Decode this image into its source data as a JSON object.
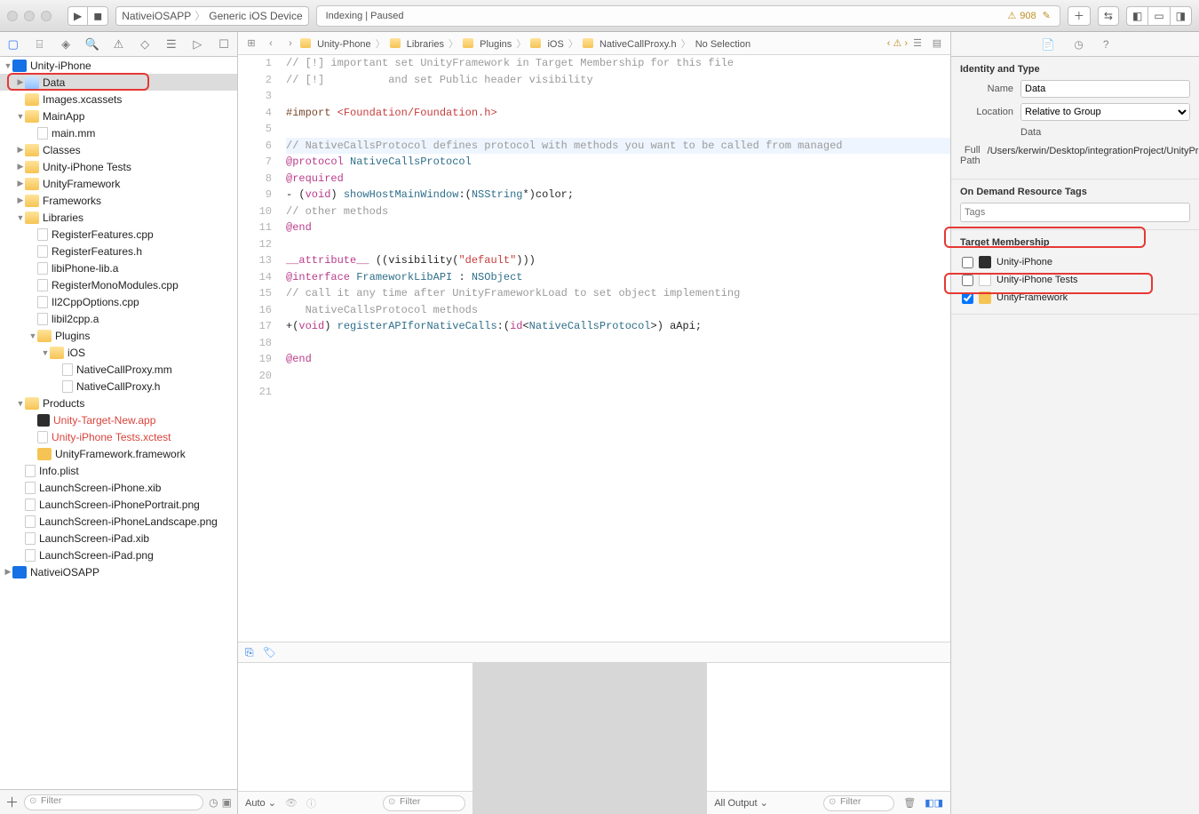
{
  "toolbar": {
    "scheme_app": "NativeiOSAPP",
    "scheme_device": "Generic iOS Device",
    "status_text": "Indexing | Paused",
    "warn_count": "908"
  },
  "navigator": {
    "project": "Unity-iPhone",
    "items": [
      {
        "l": 1,
        "t": "proj",
        "d": "▼",
        "label": "Unity-iPhone"
      },
      {
        "l": 2,
        "t": "folder-blue",
        "d": "▶",
        "label": "Data",
        "sel": true,
        "box": true
      },
      {
        "l": 2,
        "t": "folder",
        "d": "",
        "label": "Images.xcassets"
      },
      {
        "l": 2,
        "t": "folder",
        "d": "▼",
        "label": "MainApp"
      },
      {
        "l": 3,
        "t": "file",
        "d": "",
        "label": "main.mm"
      },
      {
        "l": 2,
        "t": "folder",
        "d": "▶",
        "label": "Classes"
      },
      {
        "l": 2,
        "t": "folder",
        "d": "▶",
        "label": "Unity-iPhone Tests"
      },
      {
        "l": 2,
        "t": "folder",
        "d": "▶",
        "label": "UnityFramework"
      },
      {
        "l": 2,
        "t": "folder",
        "d": "▶",
        "label": "Frameworks"
      },
      {
        "l": 2,
        "t": "folder",
        "d": "▼",
        "label": "Libraries"
      },
      {
        "l": 3,
        "t": "file",
        "d": "",
        "label": "RegisterFeatures.cpp"
      },
      {
        "l": 3,
        "t": "file",
        "d": "",
        "label": "RegisterFeatures.h"
      },
      {
        "l": 3,
        "t": "file",
        "d": "",
        "label": "libiPhone-lib.a"
      },
      {
        "l": 3,
        "t": "file",
        "d": "",
        "label": "RegisterMonoModules.cpp"
      },
      {
        "l": 3,
        "t": "file",
        "d": "",
        "label": "Il2CppOptions.cpp"
      },
      {
        "l": 3,
        "t": "file",
        "d": "",
        "label": "libil2cpp.a"
      },
      {
        "l": 3,
        "t": "folder",
        "d": "▼",
        "label": "Plugins"
      },
      {
        "l": 4,
        "t": "folder",
        "d": "▼",
        "label": "iOS"
      },
      {
        "l": 5,
        "t": "file",
        "d": "",
        "label": "NativeCallProxy.mm"
      },
      {
        "l": 5,
        "t": "file",
        "d": "",
        "label": "NativeCallProxy.h"
      },
      {
        "l": 2,
        "t": "folder",
        "d": "▼",
        "label": "Products"
      },
      {
        "l": 3,
        "t": "app",
        "d": "",
        "label": "Unity-Target-New.app",
        "red": true
      },
      {
        "l": 3,
        "t": "xc",
        "d": "",
        "label": "Unity-iPhone Tests.xctest",
        "red": true
      },
      {
        "l": 3,
        "t": "fw",
        "d": "",
        "label": "UnityFramework.framework"
      },
      {
        "l": 2,
        "t": "file",
        "d": "",
        "label": "Info.plist"
      },
      {
        "l": 2,
        "t": "file",
        "d": "",
        "label": "LaunchScreen-iPhone.xib"
      },
      {
        "l": 2,
        "t": "file",
        "d": "",
        "label": "LaunchScreen-iPhonePortrait.png"
      },
      {
        "l": 2,
        "t": "file",
        "d": "",
        "label": "LaunchScreen-iPhoneLandscape.png"
      },
      {
        "l": 2,
        "t": "file",
        "d": "",
        "label": "LaunchScreen-iPad.xib"
      },
      {
        "l": 2,
        "t": "file",
        "d": "",
        "label": "LaunchScreen-iPad.png"
      },
      {
        "l": 1,
        "t": "proj",
        "d": "▶",
        "label": "NativeiOSAPP"
      }
    ],
    "filter_placeholder": "Filter"
  },
  "breadcrumb": [
    "Unity-Phone",
    "Libraries",
    "Plugins",
    "iOS",
    "NativeCallProxy.h",
    "No Selection"
  ],
  "code_lines": [
    {
      "n": 1,
      "html": "<span class='tok-c'>// [!] important set UnityFramework in Target Membership for this file</span>"
    },
    {
      "n": 2,
      "html": "<span class='tok-c'>// [!]          and set Public header visibility</span>"
    },
    {
      "n": 3,
      "html": ""
    },
    {
      "n": 4,
      "html": "<span class='tok-d'>#import</span> <span class='tok-i'>&lt;Foundation/Foundation.h&gt;</span>"
    },
    {
      "n": 5,
      "html": ""
    },
    {
      "n": 6,
      "sel": true,
      "html": "<span class='tok-c'>// NativeCallsProtocol defines protocol with methods you want to be called from managed</span>"
    },
    {
      "n": 7,
      "html": "<span class='tok-k'>@protocol</span> <span class='tok-t'>NativeCallsProtocol</span>"
    },
    {
      "n": 8,
      "html": "<span class='tok-k'>@required</span>"
    },
    {
      "n": 9,
      "html": "- (<span class='tok-k'>void</span>) <span class='tok-fn'>showHostMainWindow</span>:(<span class='tok-t'>NSString</span>*)color;"
    },
    {
      "n": 10,
      "html": "<span class='tok-c'>// other methods</span>"
    },
    {
      "n": 11,
      "html": "<span class='tok-k'>@end</span>"
    },
    {
      "n": 12,
      "html": ""
    },
    {
      "n": 13,
      "html": "<span class='tok-k'>__attribute__</span> ((visibility(<span class='tok-i'>\"default\"</span>)))"
    },
    {
      "n": 14,
      "html": "<span class='tok-k'>@interface</span> <span class='tok-t'>FrameworkLibAPI</span> : <span class='tok-t'>NSObject</span>"
    },
    {
      "n": 15,
      "html": "<span class='tok-c'>// call it any time after UnityFrameworkLoad to set object implementing</span>"
    },
    {
      "n": "",
      "html": "   <span class='tok-c'>NativeCallsProtocol methods</span>"
    },
    {
      "n": 16,
      "html": "+(<span class='tok-k'>void</span>) <span class='tok-fn'>registerAPIforNativeCalls</span>:(<span class='tok-k'>id</span>&lt;<span class='tok-t'>NativeCallsProtocol</span>&gt;) aApi;"
    },
    {
      "n": 17,
      "html": ""
    },
    {
      "n": 18,
      "html": "<span class='tok-k'>@end</span>"
    },
    {
      "n": 19,
      "html": ""
    },
    {
      "n": 20,
      "html": ""
    },
    {
      "n": 21,
      "html": ""
    }
  ],
  "debug": {
    "auto": "Auto",
    "all_output": "All Output",
    "filter": "Filter"
  },
  "inspector": {
    "section_identity": "Identity and Type",
    "name_label": "Name",
    "name_value": "Data",
    "location_label": "Location",
    "location_value": "Relative to Group",
    "location_path": "Data",
    "fullpath_label": "Full Path",
    "fullpath_value": "/Users/kerwin/Desktop/integrationProject/UnityProject/Data",
    "odr_title": "On Demand Resource Tags",
    "odr_placeholder": "Tags",
    "tm_title": "Target Membership",
    "tm_items": [
      {
        "checked": false,
        "icon": "app",
        "label": "Unity-iPhone"
      },
      {
        "checked": false,
        "icon": "test",
        "label": "Unity-iPhone Tests"
      },
      {
        "checked": true,
        "icon": "fw",
        "label": "UnityFramework"
      }
    ]
  }
}
